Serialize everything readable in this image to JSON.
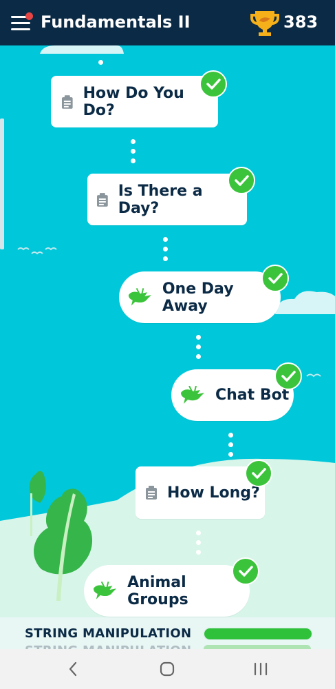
{
  "header": {
    "title": "Fundamentals II",
    "score": "383",
    "menu_icon": "hamburger-menu-icon",
    "trophy_icon": "trophy-icon",
    "notification_color": "#e64545"
  },
  "lessons": [
    {
      "label": "How Do You Do?",
      "type": "quiz",
      "icon": "clipboard-icon",
      "completed": true
    },
    {
      "label": "Is There a Day?",
      "type": "quiz",
      "icon": "clipboard-icon",
      "completed": true
    },
    {
      "label": "One Day Away",
      "type": "lesson",
      "icon": "cricket-icon",
      "completed": true
    },
    {
      "label": "Chat Bot",
      "type": "lesson",
      "icon": "cricket-icon",
      "completed": true
    },
    {
      "label": "How Long?",
      "type": "quiz",
      "icon": "clipboard-icon",
      "completed": true
    },
    {
      "label": "Animal Groups",
      "type": "lesson",
      "icon": "cricket-icon",
      "completed": true
    }
  ],
  "section": {
    "label": "STRING MANIPULATION",
    "next_label": "STRING MANIPULATION",
    "progress": 1.0
  },
  "nav": {
    "back_icon": "back-icon",
    "home_icon": "home-icon",
    "recents_icon": "recents-icon"
  },
  "colors": {
    "background": "#00c8da",
    "header": "#0b2a45",
    "check": "#3bc43b",
    "hill": "#d8f5ea",
    "tree": "#35b54a"
  }
}
